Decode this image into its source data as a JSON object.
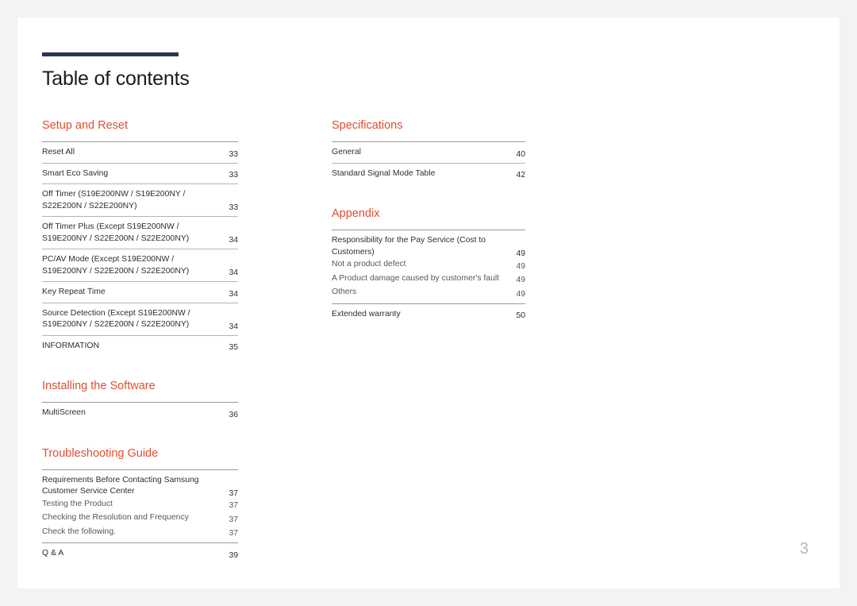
{
  "document": {
    "title": "Table of contents",
    "folio": "3",
    "accent_color": "#e04e30",
    "rule_color": "#2b3350"
  },
  "columns": {
    "left": [
      {
        "heading": "Setup and Reset",
        "entries": [
          {
            "label": "Reset All",
            "page": "33",
            "style": "main"
          },
          {
            "label": "Smart Eco Saving",
            "page": "33",
            "style": "main"
          },
          {
            "label": "Off Timer (S19E200NW / S19E200NY / S22E200N / S22E200NY)",
            "page": "33",
            "style": "main"
          },
          {
            "label": "Off Timer Plus (Except S19E200NW / S19E200NY / S22E200N / S22E200NY)",
            "page": "34",
            "style": "main"
          },
          {
            "label": "PC/AV Mode (Except S19E200NW / S19E200NY / S22E200N / S22E200NY)",
            "page": "34",
            "style": "main"
          },
          {
            "label": "Key Repeat Time",
            "page": "34",
            "style": "main"
          },
          {
            "label": "Source Detection (Except S19E200NW / S19E200NY / S22E200N / S22E200NY)",
            "page": "34",
            "style": "main"
          },
          {
            "label": "INFORMATION",
            "page": "35",
            "style": "main"
          }
        ]
      },
      {
        "heading": "Installing the Software",
        "entries": [
          {
            "label": "MultiScreen",
            "page": "36",
            "style": "main"
          }
        ]
      },
      {
        "heading": "Troubleshooting Guide",
        "entries": [
          {
            "label": "Requirements Before Contacting Samsung Customer Service Center",
            "page": "37",
            "style": "group-parent"
          },
          {
            "label": "Testing the Product",
            "page": "37",
            "style": "sub"
          },
          {
            "label": "Checking the Resolution and Frequency",
            "page": "37",
            "style": "sub"
          },
          {
            "label": "Check the following.",
            "page": "37",
            "style": "sub-last"
          },
          {
            "label": "Q & A",
            "page": "39",
            "style": "main"
          }
        ]
      }
    ],
    "right": [
      {
        "heading": "Specifications",
        "entries": [
          {
            "label": "General",
            "page": "40",
            "style": "main"
          },
          {
            "label": "Standard Signal Mode Table",
            "page": "42",
            "style": "main"
          }
        ]
      },
      {
        "heading": "Appendix",
        "entries": [
          {
            "label": "Responsibility for the Pay Service (Cost to Customers)",
            "page": "49",
            "style": "group-parent"
          },
          {
            "label": "Not a product defect",
            "page": "49",
            "style": "sub"
          },
          {
            "label": "A Product damage caused by customer's fault",
            "page": "49",
            "style": "sub"
          },
          {
            "label": "Others",
            "page": "49",
            "style": "sub-last"
          },
          {
            "label": "Extended warranty",
            "page": "50",
            "style": "main"
          }
        ]
      }
    ]
  }
}
